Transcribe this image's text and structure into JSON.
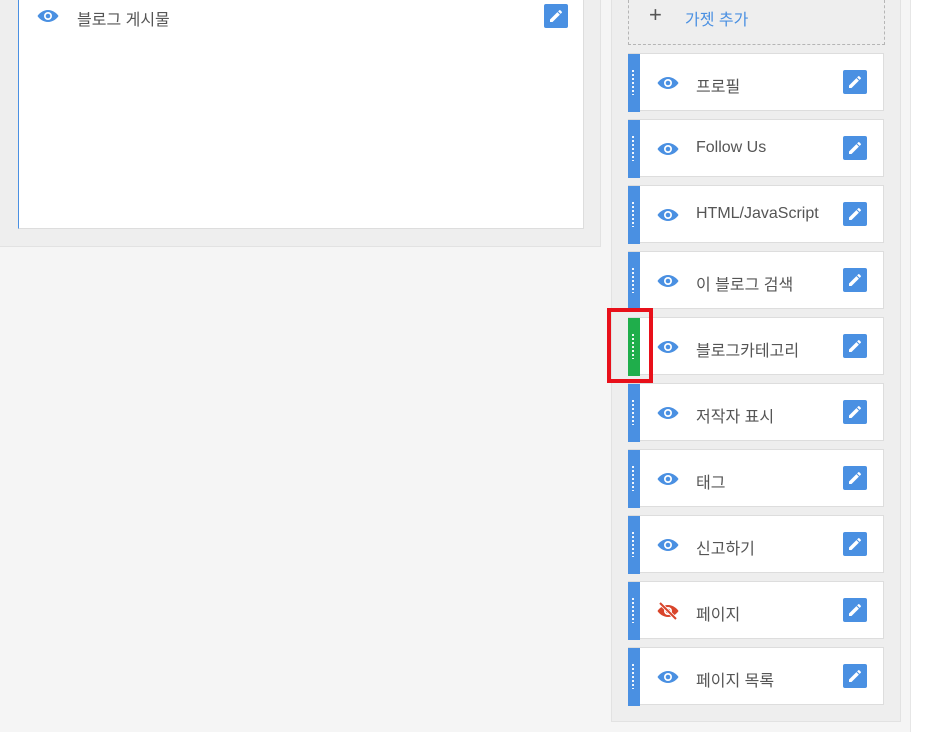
{
  "main": {
    "blog_posts_label": "블로그 게시물"
  },
  "sidebar": {
    "add_gadget_label": "가젯 추가",
    "add_gadget_icon": "+",
    "gadgets": [
      {
        "label": "프로필",
        "visible": true
      },
      {
        "label": "Follow Us",
        "visible": true
      },
      {
        "label": "HTML/JavaScript",
        "visible": true
      },
      {
        "label": "이 블로그 검색",
        "visible": true
      },
      {
        "label": "블로그카테고리",
        "visible": true,
        "highlighted": true
      },
      {
        "label": "저작자 표시",
        "visible": true
      },
      {
        "label": "태그",
        "visible": true
      },
      {
        "label": "신고하기",
        "visible": true
      },
      {
        "label": "페이지",
        "visible": false
      },
      {
        "label": "페이지 목록",
        "visible": true
      }
    ]
  },
  "colors": {
    "accent": "#4a90e2",
    "drag_active": "#1fae4b",
    "hidden_icon": "#d9452b",
    "highlight": "#e8101a"
  },
  "icons": {
    "visible": "eye-icon",
    "hidden": "eye-off-icon",
    "edit": "pencil-icon",
    "drag": "drag-handle-icon"
  }
}
